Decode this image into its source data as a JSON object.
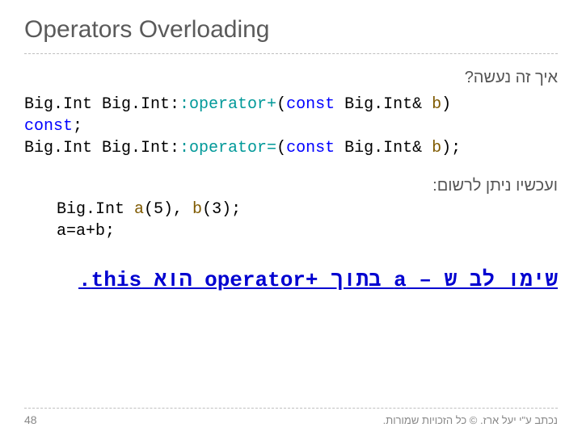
{
  "title": "Operators Overloading",
  "hebrew_q": "איך זה נעשה?",
  "code1": {
    "l1a": "Big.Int Big.Int:",
    "l1op": ":operator+",
    "l1p": "(",
    "l1const": "const",
    "l1b": " Big.Int& ",
    "l1var": "b",
    "l1e": ")",
    "l2": "const",
    "l2e": ";",
    "l3a": "Big.Int Big.Int:",
    "l3op": ":operator=",
    "l3p": "(",
    "l3const": "const",
    "l3b": " Big.Int& ",
    "l3var": "b",
    "l3e": ");"
  },
  "hebrew_now": "ועכשיו ניתן לרשום:",
  "code2": {
    "l1a": "Big.Int ",
    "l1v1": "a",
    "l1p1": "(5), ",
    "l1v2": "b",
    "l1p2": "(3);",
    "l2": "a=a+b;"
  },
  "attention": {
    "pre": "שימו לב ש – ",
    "a": "a",
    "mid": " בתוך ",
    "op": "operator+",
    "post": " הוא ",
    "this": "this",
    "dot": "."
  },
  "footer": {
    "page": "48",
    "text": "נכתב ע\"י יעל ארז. © כל הזכויות שמורות."
  }
}
